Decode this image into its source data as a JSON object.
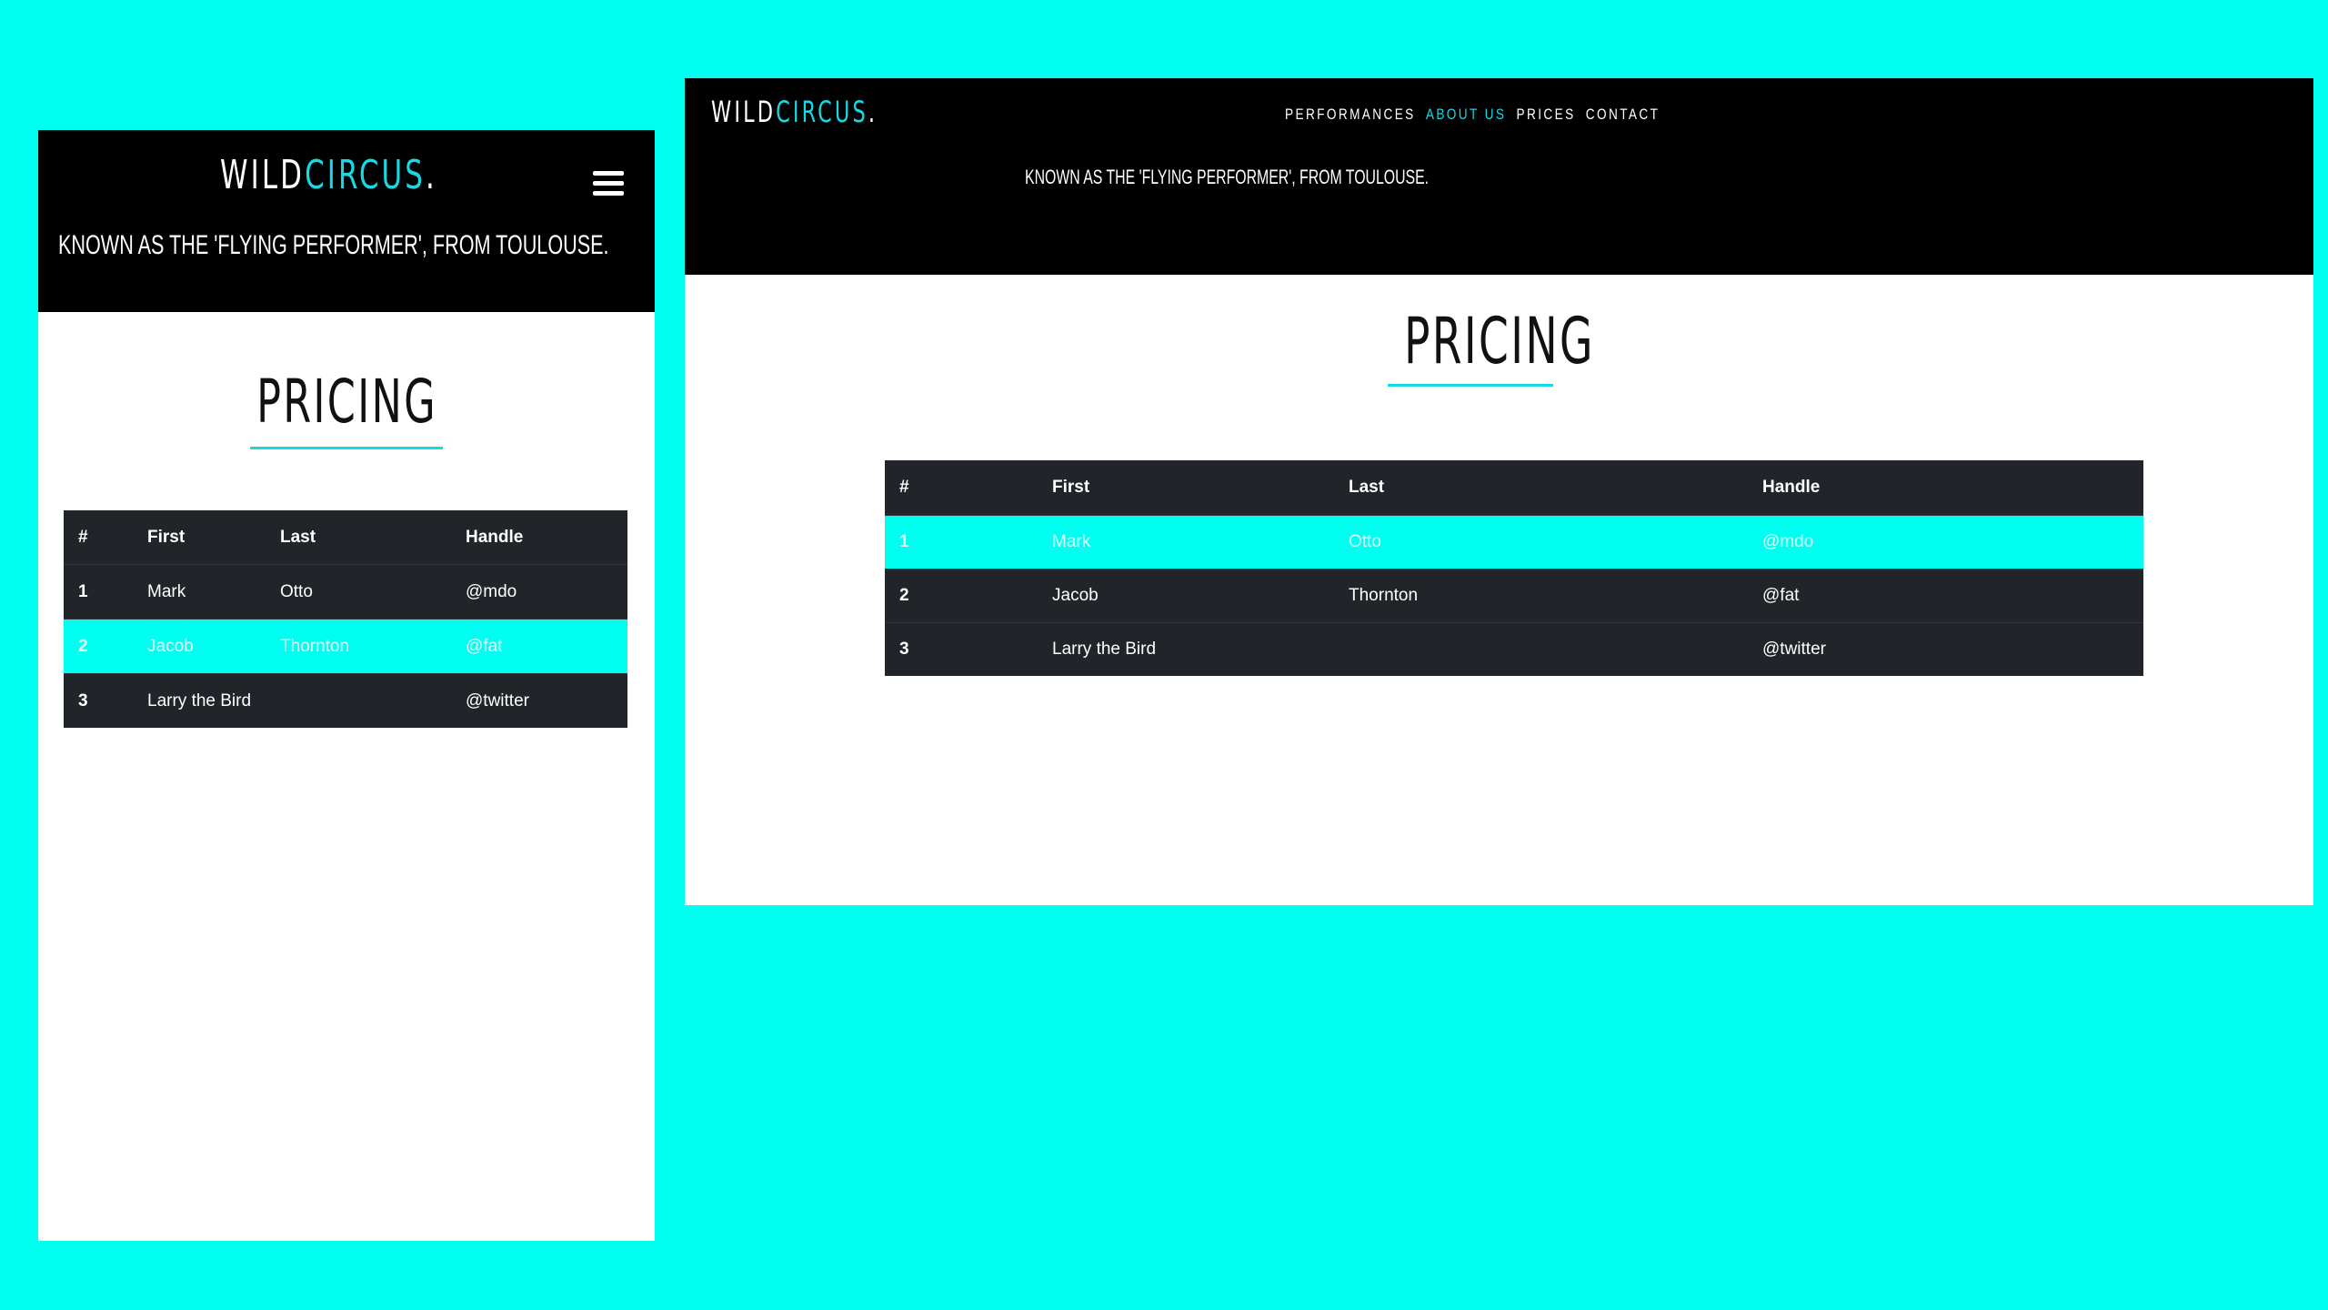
{
  "background_color": "#00FFF0",
  "accent_color": "#16D9E3",
  "mobile": {
    "logo": {
      "part1": "WILD",
      "part2": "CIRCUS",
      "dot": "."
    },
    "tagline": "KNOWN AS THE 'FLYING PERFORMER', FROM TOULOUSE.",
    "menu_icon": "hamburger-menu-icon",
    "pricing_title": "PRICING",
    "table": {
      "headers": [
        "#",
        "First",
        "Last",
        "Handle"
      ],
      "rows": [
        [
          "1",
          "Mark",
          "Otto",
          "@mdo"
        ],
        [
          "2",
          "Jacob",
          "Thornton",
          "@fat"
        ],
        [
          "3",
          "Larry the Bird",
          "",
          "@twitter"
        ]
      ]
    }
  },
  "desktop": {
    "logo": {
      "part1": "WILD",
      "part2": "CIRCUS",
      "dot": "."
    },
    "nav": [
      "PERFORMANCES",
      "ABOUT US",
      "PRICES",
      "CONTACT"
    ],
    "active_nav": "ABOUT US",
    "tagline": "KNOWN AS THE 'FLYING PERFORMER', FROM TOULOUSE.",
    "pricing_title": "PRICING",
    "table": {
      "headers": [
        "#",
        "First",
        "Last",
        "Handle"
      ],
      "rows": [
        [
          "1",
          "Mark",
          "Otto",
          "@mdo"
        ],
        [
          "2",
          "Jacob",
          "Thornton",
          "@fat"
        ],
        [
          "3",
          "Larry the Bird",
          "",
          "@twitter"
        ]
      ]
    }
  }
}
